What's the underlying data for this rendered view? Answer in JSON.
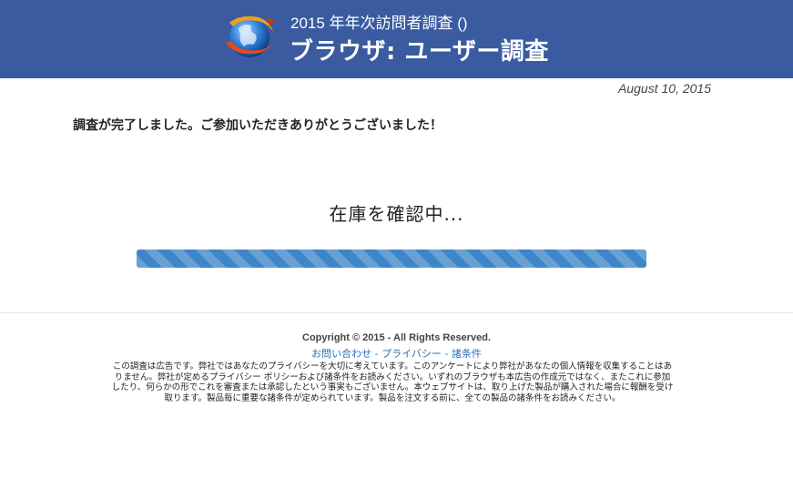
{
  "header": {
    "subtitle": "2015 年年次訪問者調査 ()",
    "title": "ブラウザ: ユーザー調査",
    "logo_icon": "browser-globe-logo-icon"
  },
  "date": "August 10, 2015",
  "thanks_message": "調査が完了しました。ご参加いただきありがとうございました！",
  "status": {
    "checking_text": "在庫を確認中...",
    "progress_percent": 100,
    "bar_color": "#3e86c8"
  },
  "footer": {
    "copyright": "Copyright © 2015 - All Rights Reserved.",
    "links": [
      "お問い合わせ",
      "プライバシー",
      "諸条件"
    ],
    "separator": " - ",
    "disclaimer": "この調査は広告です。弊社ではあなたのプライバシーを大切に考えています。このアンケートにより弊社があなたの個人情報を収集することはありません。弊社が定めるプライバシー ポリシーおよび諸条件をお読みください。いずれのブラウザも本広告の作成元ではなく、またこれに参加したり、何らかの形でこれを審査または承認したという事実もございません。本ウェブサイトは、取り上げた製品が購入された場合に報酬を受け取ります。製品毎に重要な諸条件が定められています。製品を注文する前に、全ての製品の諸条件をお読みください。"
  },
  "colors": {
    "header_bg": "#3a5ba0",
    "link": "#2a6db5"
  }
}
